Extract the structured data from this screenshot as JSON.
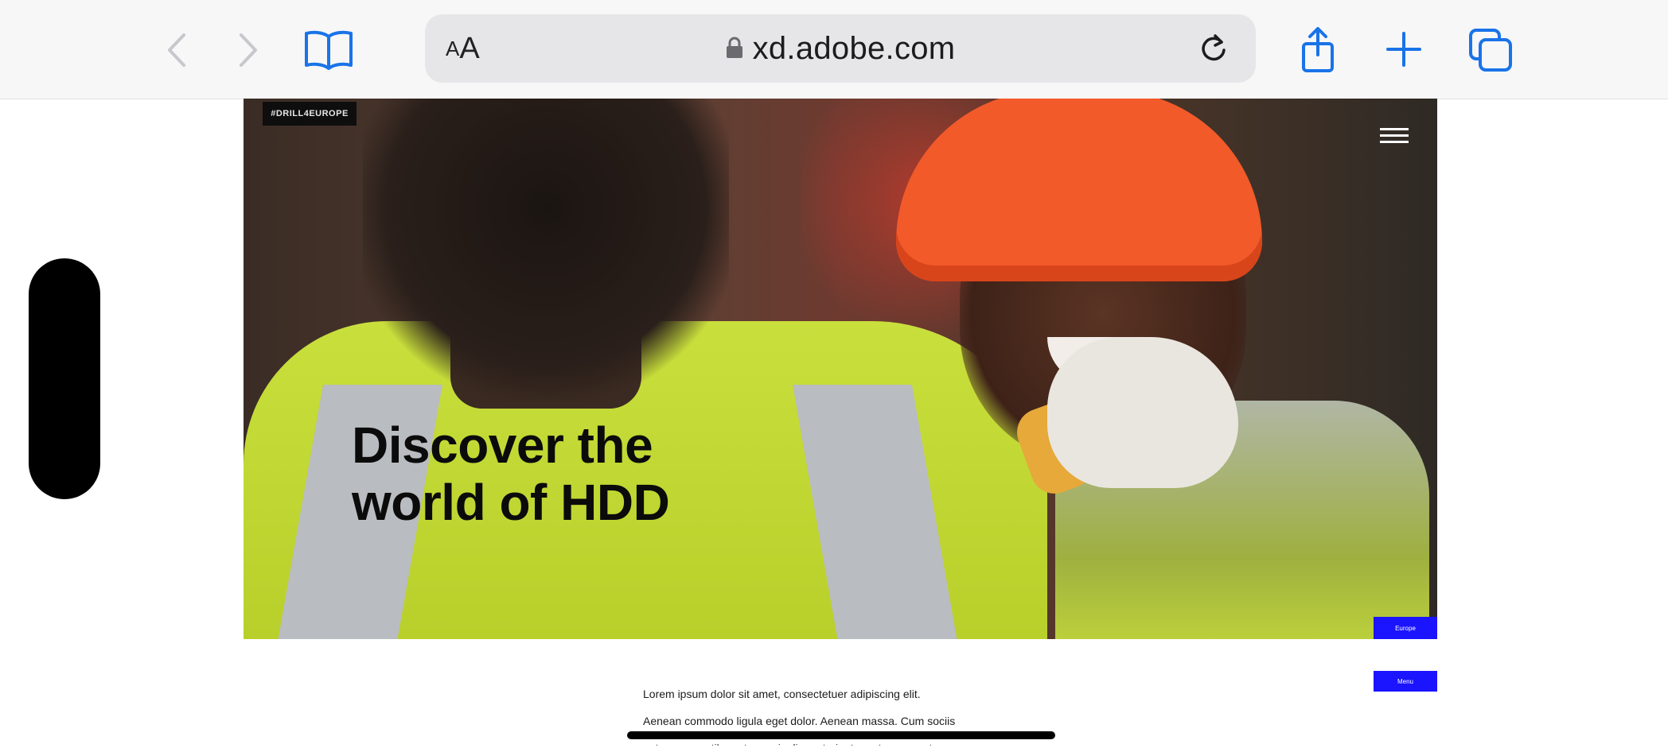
{
  "browser": {
    "text_size_small": "A",
    "text_size_large": "A",
    "url": "xd.adobe.com",
    "icons": [
      "back-icon",
      "forward-icon",
      "bookmarks-icon",
      "lock-icon",
      "reload-icon",
      "share-icon",
      "new-tab-icon",
      "tabs-icon"
    ]
  },
  "hero": {
    "tag": "#DRILL4EUROPE",
    "headline_line1": "Discover the",
    "headline_line2": "world of HDD",
    "button_primary": "Europe"
  },
  "content": {
    "button_secondary": "Menu",
    "paragraph_line1": "Lorem ipsum dolor sit amet, consectetuer adipiscing elit.",
    "paragraph_line2": "Aenean commodo ligula eget dolor. Aenean massa. Cum sociis",
    "paragraph_line3": "natoque penatibus et magnis dis parturient montes, nascetur"
  },
  "colors": {
    "accent_blue": "#1a14ff",
    "safari_blue": "#1a73e8"
  }
}
